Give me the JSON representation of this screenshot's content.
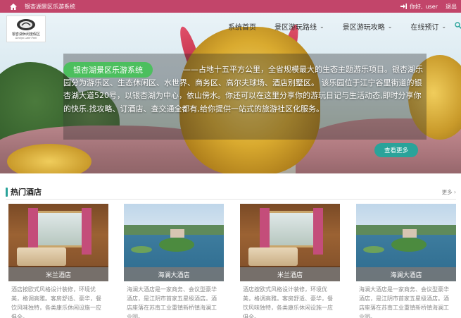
{
  "topbar": {
    "site_name": "银杏湖景区乐游系统",
    "greeting": "你好,",
    "username": "user",
    "logout": "退出",
    "bg_color": "#c2456a"
  },
  "logo": {
    "text": "银杏湖休闲度假区",
    "sub": "Ginkgo Lake Park"
  },
  "nav": {
    "items": [
      {
        "label": "系统首页",
        "dropdown": false
      },
      {
        "label": "景区游玩路线",
        "dropdown": true
      },
      {
        "label": "景区游玩攻略",
        "dropdown": true
      },
      {
        "label": "在线预订",
        "dropdown": true
      }
    ],
    "search_icon": "search-icon"
  },
  "hero": {
    "badge": "银杏湖景区乐游系统",
    "intro": "——占地十五平方公里，全省规模最大的生态主题游乐项目。银杏湖乐园分为游乐区、生态休闲区、水世界、商务区、高尔夫球场、酒店别墅区。 该乐园位于江宁谷里街道的银杏湖大道520号，以银杏湖为中心，依山傍水。你还可以在这里分享你的游玩日记与生活动态,即时分享你的快乐.找攻略、订酒店、查交通全都有,给你提供一站式的旅游社区化服务。",
    "more_btn": "查看更多",
    "accent_color": "#2aa39a",
    "badge_color": "#4cbf5e"
  },
  "section": {
    "title": "热门酒店",
    "more": "更多 ›"
  },
  "hotels": [
    {
      "name": "米兰酒店",
      "desc": "酒店按欧式风格设计装修，环境优美，格调高雅。客房舒适、豪华，餐饮风味独特，各类康乐休闲设施一应俱全。",
      "thumb": "room"
    },
    {
      "name": "海澜大酒店",
      "desc": "海澜大酒店是一家商务、会议型豪华酒店，是江阴市首家五星级酒店。酒店座落在苏南工业重镇新桥镇海澜工业园。",
      "thumb": "lake"
    },
    {
      "name": "米兰酒店",
      "desc": "酒店按欧式风格设计装修，环境优美，格调高雅。客房舒适、豪华，餐饮风味独特，各类康乐休闲设施一应俱全。",
      "thumb": "room"
    },
    {
      "name": "海澜大酒店",
      "desc": "海澜大酒店是一家商务、会议型豪华酒店，是江阴市首家五星级酒店。酒店座落在苏南工业重镇新桥镇海澜工业园。",
      "thumb": "lake"
    }
  ]
}
